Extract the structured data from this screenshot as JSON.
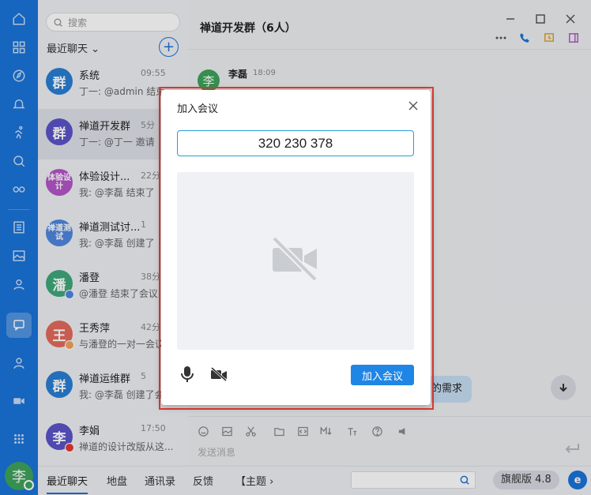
{
  "sidebar": {
    "user_avatar_char": "李"
  },
  "conversation_list": {
    "search_placeholder": "搜索",
    "section_label": "最近聊天",
    "add_label": "+",
    "items": [
      {
        "avatar": "群",
        "name": "系统",
        "time": "09:55",
        "preview": "丁一: @admin 结束",
        "color": "#2a7fd4"
      },
      {
        "avatar": "群",
        "name": "禅道开发群",
        "time": "5分",
        "preview": "丁一: @丁一 邀请",
        "color": "#5b54c9"
      },
      {
        "avatar": "体验设计",
        "name": "体验设计...",
        "time": "22分",
        "preview": "我: @李磊 结束了",
        "color": "#b356c6"
      },
      {
        "avatar": "禅道测试",
        "name": "禅道测试讨...",
        "time": "1",
        "preview": "我: @李磊 创建了",
        "color": "#4f87e0"
      },
      {
        "avatar": "潘",
        "name": "潘登",
        "time": "38分",
        "preview": "@潘登 结束了会议",
        "color": "#3ea87a"
      },
      {
        "avatar": "王",
        "name": "王秀萍",
        "time": "42分",
        "preview": "与潘登的一对一会议",
        "color": "#e36a5c"
      },
      {
        "avatar": "群",
        "name": "禅道运维群",
        "time": "5",
        "preview": "我: @李磊 创建了会",
        "color": "#2a7fd4"
      },
      {
        "avatar": "李",
        "name": "李娟",
        "time": "17:50",
        "preview": "禅道的设计改版从这...",
        "color": "#5b54c9"
      }
    ]
  },
  "chat": {
    "title": "禅道开发群（6人）",
    "message_author": "李磊",
    "message_avatar": "李",
    "message_time": "18:09",
    "bubble_text": "的需求",
    "composer_placeholder": "发送消息"
  },
  "bottom_bar": {
    "tabs": [
      "最近聊天",
      "地盘",
      "通讯录",
      "反馈",
      "【主题 ›"
    ],
    "edition": "旗舰版 4.8",
    "logo": "e"
  },
  "dialog": {
    "title": "加入会议",
    "meeting_id": "320 230 378",
    "join_label": "加入会议"
  },
  "colors": {
    "primary": "#1a73d9",
    "join_button": "#1f86e5",
    "highlight_frame": "#e23a2f"
  }
}
